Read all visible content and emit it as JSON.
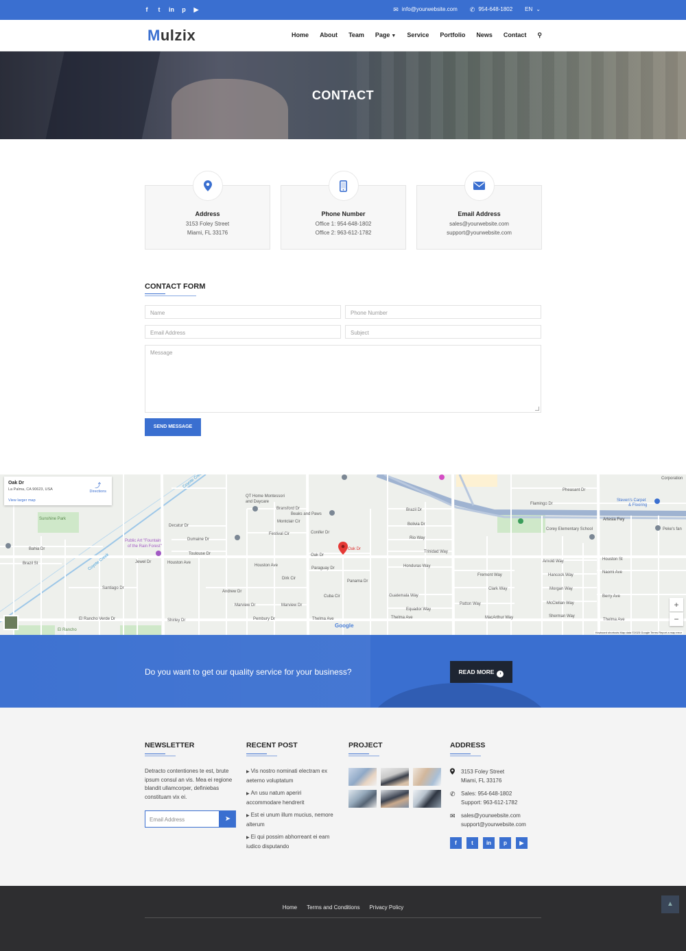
{
  "topbar": {
    "social": [
      "f",
      "t",
      "in",
      "p",
      "yt"
    ],
    "email": "info@yourwebsite.com",
    "phone": "954-648-1802",
    "language": "EN"
  },
  "nav": {
    "logo_first": "M",
    "logo_rest": "ulzix",
    "items": [
      "Home",
      "About",
      "Team",
      "Page",
      "Service",
      "Portfolio",
      "News",
      "Contact"
    ]
  },
  "hero": {
    "title": "CONTACT"
  },
  "info_boxes": [
    {
      "title": "Address",
      "line1": "3153 Foley Street",
      "line2": "Miami, FL 33176",
      "icon": "map-pin-icon"
    },
    {
      "title": "Phone Number",
      "line1": "Office 1: 954-648-1802",
      "line2": "Office 2: 963-612-1782",
      "icon": "mobile-phone-icon"
    },
    {
      "title": "Email Address",
      "line1": "sales@yourwebsite.com",
      "line2": "support@yourwebsite.com",
      "icon": "envelope-icon"
    }
  ],
  "contact_form": {
    "title": "CONTACT FORM",
    "name_placeholder": "Name",
    "phone_placeholder": "Phone Number",
    "email_placeholder": "Email Address",
    "subject_placeholder": "Subject",
    "message_placeholder": "Message",
    "send_label": "SEND MESSAGE"
  },
  "map": {
    "place_title": "Oak Dr",
    "place_address": "La Palma, CA 90623, USA",
    "directions_label": "Directions",
    "larger_map_label": "View larger map",
    "pin_label": "Oak Dr",
    "google_label": "Google",
    "footer_text": "Keyboard shortcuts   Map data ©2023 Google   Terms   Report a map error",
    "streets": [
      "Houston Ave",
      "Marview Dr",
      "Andrew Dr",
      "Paraguay Dr",
      "Panama Dr",
      "Honduras Way",
      "Guatemala Way",
      "Equador Way",
      "Thelma Ave",
      "Artesia Fwy",
      "Flamingo Dr",
      "Pheasant Dr",
      "Bolivia Dr",
      "Brazil Dr",
      "Rio Way",
      "Trinidad Way",
      "Fremont Way",
      "Clark Way",
      "Arnold Way",
      "Hancock Way",
      "Morgan Way",
      "McClellan Way",
      "Sherman Way",
      "Houston St",
      "Naomi Ave",
      "Berry Ave",
      "MacArthur Way",
      "Patton Way",
      "Toulouse Dr",
      "Dumaine Dr",
      "Decatur Dr",
      "Bransford Dr",
      "Conifer Dr",
      "Festival Cir",
      "Montclair Cir",
      "Oak Dr",
      "Dirk Cir",
      "Cuba Cir",
      "Pembury Dr",
      "Shirley Dr",
      "Jewel Dr",
      "Sunshine Park",
      "El Rancho",
      "Coyote Creek"
    ],
    "pois": [
      "QT Home Montessori and Daycare",
      "Beaks and Paws",
      "Public Art \"Fountain of the Rain Forest\"",
      "Steven's Carpet & Flooring",
      "Corey Elementary School",
      "Corporation",
      "Peke's fan"
    ]
  },
  "cta": {
    "text": "Do you want to get our quality service for your business?",
    "button_label": "READ MORE"
  },
  "footer": {
    "newsletter": {
      "title": "NEWSLETTER",
      "text": "Detracto contentiones te est, brute ipsum consul an vis. Mea ei regione blandit ullamcorper, definiebas constituam vix ei.",
      "email_placeholder": "Email Address"
    },
    "recent_post": {
      "title": "RECENT POST",
      "posts": [
        "Vis nostro nominati electram ex aeterno voluptatum",
        "An usu natum aperiri accommodare hendrerit",
        "Est ei unum illum mucius, nemore alterum",
        "Ei qui possim abhorreant ei eam iudico disputando"
      ]
    },
    "project": {
      "title": "PROJECT",
      "count": 6
    },
    "address": {
      "title": "ADDRESS",
      "street": "3153 Foley Street",
      "city": "Miami, FL 33176",
      "sales": "Sales: 954-648-1802",
      "support": "Support: 963-612-1782",
      "email1": "sales@yourwebsite.com",
      "email2": "support@yourwebsite.com",
      "social": [
        "f",
        "t",
        "in",
        "p",
        "yt"
      ]
    }
  },
  "bottom": {
    "links": [
      "Home",
      "Terms and Conditions",
      "Privacy Policy"
    ]
  },
  "colors": {
    "accent": "#3a6fd0",
    "dark": "#2e2e30",
    "cta_button": "#1e2532"
  }
}
